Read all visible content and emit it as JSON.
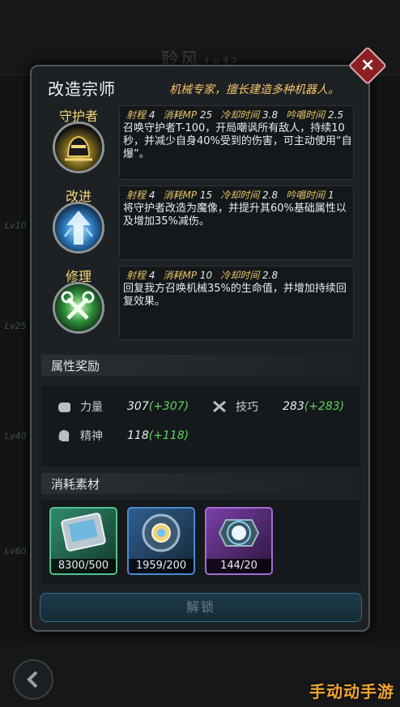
{
  "background": {
    "title": "聆风",
    "level": "Lv32",
    "side_levels": [
      "Lv10",
      "Lv25",
      "Lv40",
      "Lv60"
    ]
  },
  "dialog": {
    "title": "改造宗师",
    "description": "机械专家，擅长建造多种机器人。",
    "close_icon": "close-x-icon",
    "skills": [
      {
        "name": "守护者",
        "icon": "helmet-guardian-icon",
        "stats": [
          {
            "label": "射程",
            "value": "4"
          },
          {
            "label": "消耗MP",
            "value": "25"
          },
          {
            "label": "冷却时间",
            "value": "3.8"
          },
          {
            "label": "吟唱时间",
            "value": "2.5"
          }
        ],
        "text": "召唤守护者T-100，开局嘲讽所有敌人，持续10秒，并减少自身40%受到的伤害，可主动使用“自爆”。"
      },
      {
        "name": "改进",
        "icon": "upgrade-arrow-icon",
        "stats": [
          {
            "label": "射程",
            "value": "4"
          },
          {
            "label": "消耗MP",
            "value": "15"
          },
          {
            "label": "冷却时间",
            "value": "2.8"
          },
          {
            "label": "吟唱时间",
            "value": "1"
          }
        ],
        "text": "将守护者改造为魔像，并提升其60%基础属性以及增加35%减伤。"
      },
      {
        "name": "修理",
        "icon": "wrench-repair-icon",
        "stats": [
          {
            "label": "射程",
            "value": "4"
          },
          {
            "label": "消耗MP",
            "value": "10"
          },
          {
            "label": "冷却时间",
            "value": "2.8"
          }
        ],
        "text": "回复我方召唤机械35%的生命值，并增加持续回复效果。"
      }
    ],
    "attributes_header": "属性奖励",
    "attributes": [
      {
        "label": "力量",
        "base": "307",
        "bonus": "(+307)",
        "icon": "fist-icon"
      },
      {
        "label": "技巧",
        "base": "283",
        "bonus": "(+283)",
        "icon": "crossed-tools-icon"
      },
      {
        "label": "精神",
        "base": "118",
        "bonus": "(+118)",
        "icon": "head-mind-icon"
      }
    ],
    "materials_header": "消耗素材",
    "materials": [
      {
        "count": "8300/500",
        "icon": "circuit-chip-icon",
        "color": "#2f8b6b"
      },
      {
        "count": "1959/200",
        "icon": "mech-core-icon",
        "color": "#2f5f8f"
      },
      {
        "count": "144/20",
        "icon": "energy-core-icon",
        "color": "#7a3fa8"
      }
    ],
    "unlock_label": "解锁"
  },
  "watermark": "手动动手游",
  "colors": {
    "accent_gold": "#f4c56a",
    "bonus_green": "#5fd35f",
    "close_red": "#8b1f22"
  }
}
